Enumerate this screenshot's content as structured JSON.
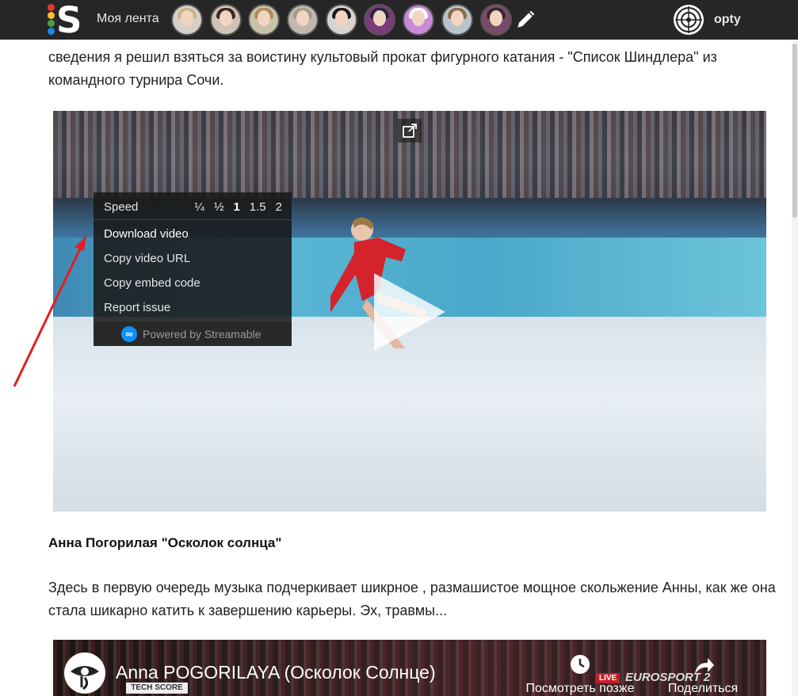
{
  "topbar": {
    "logo_letter": "S",
    "logo_dot_colors": [
      "#e53935",
      "#fbc02d",
      "#43a047",
      "#1e88e5"
    ],
    "feed_label": "Моя лента",
    "avatars": [
      {
        "hair": "#c9b48a",
        "bg": "#d8d0c8"
      },
      {
        "hair": "#3a2a20",
        "bg": "#cfc2b6"
      },
      {
        "hair": "#b08a5a",
        "bg": "#c8c2a8"
      },
      {
        "hair": "#a89a8a",
        "bg": "#bfb8ae"
      },
      {
        "hair": "#1a1a1a",
        "bg": "#d9d4cf"
      },
      {
        "hair": "#2a2a35",
        "bg": "#7a3a7a"
      },
      {
        "hair": "#ffffff",
        "bg": "#c88bd8"
      },
      {
        "hair": "#8a6a4a",
        "bg": "#b8c4cc"
      },
      {
        "hair": "#3a2a2a",
        "bg": "#7a4a6a"
      }
    ],
    "user_name": "opty"
  },
  "article": {
    "intro": "сведения я решил взяться за воистину культовый прокат фигурного катания - \"Список Шиндлера\" из командного турнира Сочи.",
    "heading": "Анна Погорилая \"Осколок солнца\"",
    "para2": "Здесь в первую очередь музыка подчеркивает шикрное , размашистое мощное скольжение Анны, как же она стала шикарно катить к завершению карьеры. Эх, травмы..."
  },
  "video1": {
    "menu": {
      "speed_label": "Speed",
      "speeds": [
        "¼",
        "½",
        "1",
        "1.5",
        "2"
      ],
      "active_speed": "1",
      "download": "Download video",
      "copy_url": "Copy video URL",
      "copy_embed": "Copy embed code",
      "report": "Report issue",
      "powered": "Powered by Streamable"
    }
  },
  "video2": {
    "title": "Anna POGORILAYA (Осколок Солнце)",
    "tech_score": "TECH SCORE",
    "watch_later": "Посмотреть позже",
    "live": "LIVE",
    "channel": "EUROSPORT 2",
    "share": "Поделиться"
  },
  "colors": {
    "accent_arrow": "#e02020",
    "topbar_bg": "#262626"
  }
}
